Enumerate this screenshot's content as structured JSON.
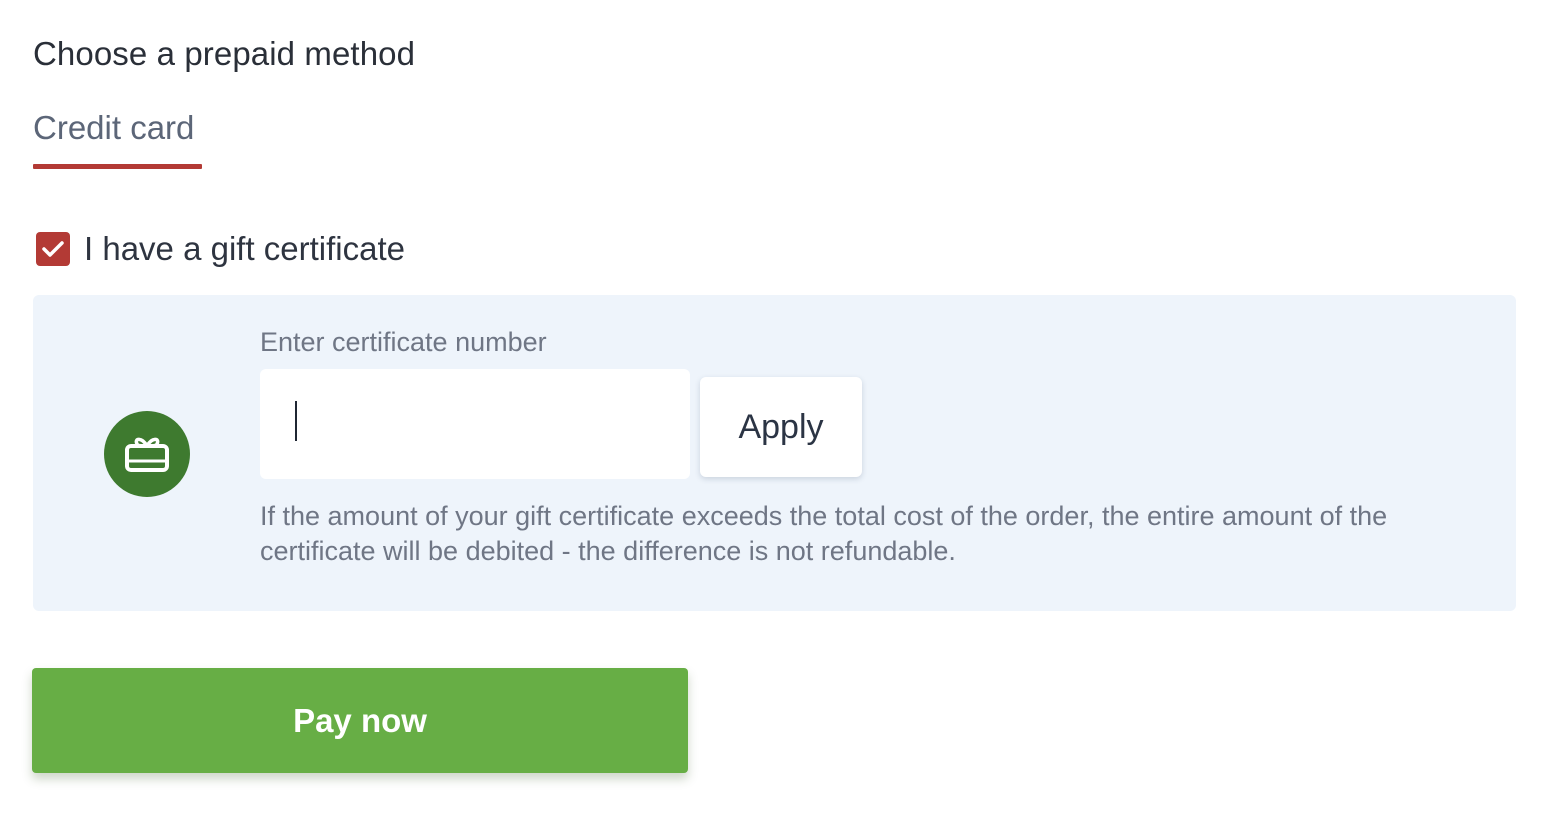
{
  "section": {
    "title": "Choose a prepaid method"
  },
  "tabs": [
    {
      "label": "Credit card",
      "active": true
    }
  ],
  "gift_certificate": {
    "checkbox_label": "I have a gift certificate",
    "checked": true,
    "input_label": "Enter certificate number",
    "input_value": "",
    "apply_label": "Apply",
    "note": "If the amount of your gift certificate exceeds the total cost of the order, the entire amount of the certificate will be debited - the difference is not refundable.",
    "icon": "gift-card-icon"
  },
  "actions": {
    "pay_label": "Pay now"
  },
  "colors": {
    "accent_red": "#b33a35",
    "pay_green": "#67ae45",
    "icon_green": "#3e7a2f",
    "panel_bg": "#eef4fb"
  }
}
